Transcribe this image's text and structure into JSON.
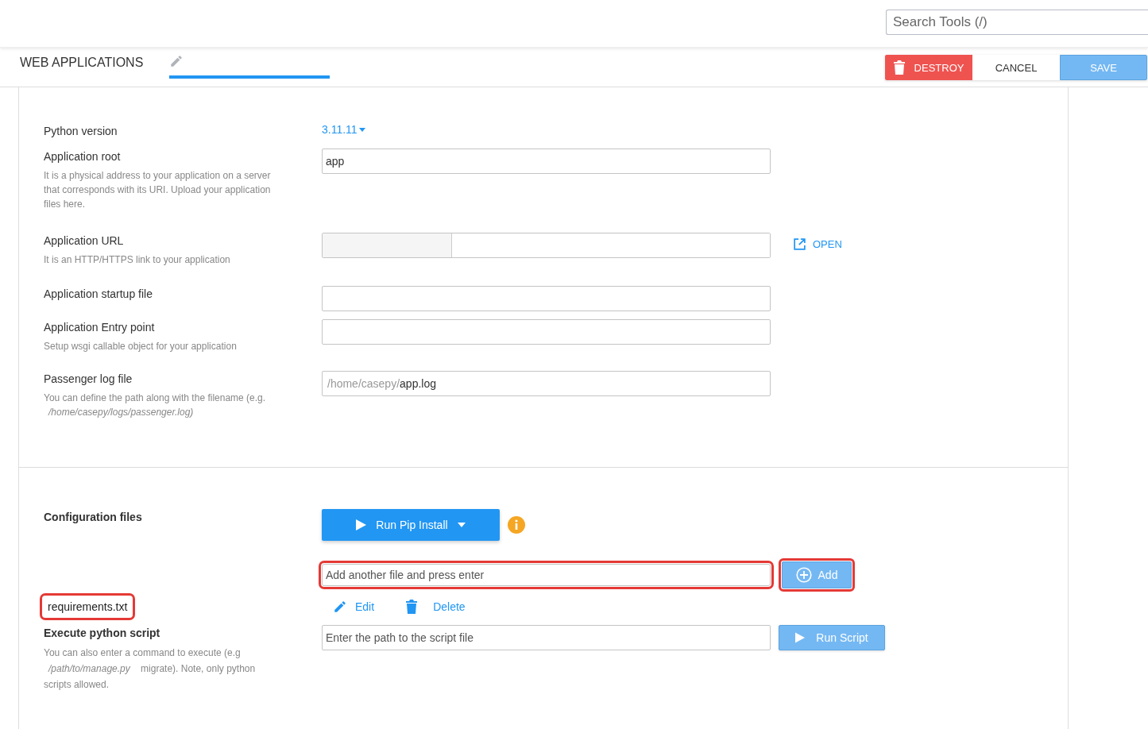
{
  "search": {
    "placeholder": "Search Tools (/)"
  },
  "page_title": "WEB APPLICATIONS",
  "actions": [
    {
      "label": "DESTROY",
      "kind": "danger"
    },
    {
      "label": "CANCEL",
      "kind": "plain"
    },
    {
      "label": "SAVE",
      "kind": "primary",
      "disabled": true
    }
  ],
  "python_version": {
    "label": "Python version",
    "value": "3.11.11"
  },
  "fields": [
    {
      "kind": "text",
      "label": "Application root",
      "help": "It is a physical address to your application on a server that corresponds with its URI. Upload your application files here.",
      "value": "app"
    },
    {
      "kind": "url",
      "label": "Application URL",
      "help": "It is an HTTP/HTTPS link to your application",
      "link": "OPEN"
    },
    {
      "kind": "text",
      "label": "Application startup file"
    },
    {
      "kind": "text",
      "label": "Application Entry point",
      "help": "Setup wsgi callable object for your application"
    },
    {
      "kind": "prefixed",
      "label": "Passenger log file",
      "help": "You can define the path along with the filename (e.g.",
      "help_example": "/home/casepy/logs/passenger.log)",
      "prefix": "/home/casepy/",
      "value": "app.log"
    }
  ],
  "config": {
    "label": "Configuration files",
    "pip_button": "Run Pip Install",
    "add_field": {
      "placeholder": "Add another file and press enter",
      "highlighted": true
    },
    "add_button": {
      "label": "Add",
      "disabled": true,
      "highlighted": true
    },
    "files": [
      {
        "name": "requirements.txt",
        "highlighted": true,
        "edit": "Edit",
        "delete": "Delete"
      }
    ]
  },
  "script": {
    "label": "Execute python script",
    "placeholder": "Enter the path to the script file",
    "button": "Run Script",
    "disabled": true,
    "help_start": "You can also enter a command to execute (e.g",
    "help_example": "/path/to/manage.py",
    "help_end": "migrate). Note, only python scripts allowed."
  }
}
